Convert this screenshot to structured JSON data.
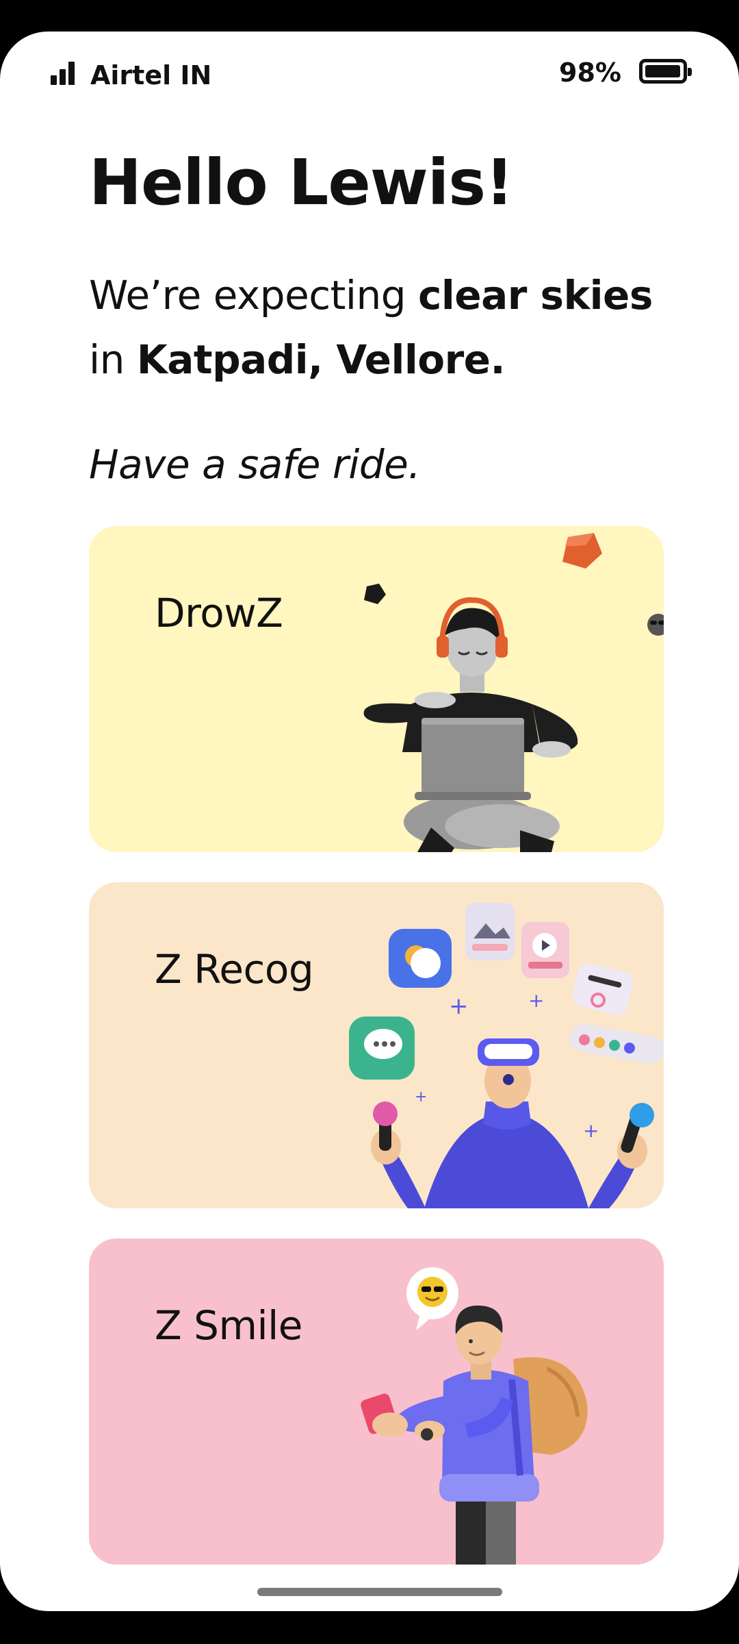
{
  "status_bar": {
    "carrier": "Airtel IN",
    "battery_percent_label": "98%",
    "battery_level": 0.98,
    "signal_bars": 3
  },
  "greeting": "Hello Lewis!",
  "forecast": {
    "prefix": "We’re expecting ",
    "condition": "clear skies",
    "middle": " in ",
    "location": "Katpadi, Vellore."
  },
  "tagline": "Have a safe ride.",
  "cards": [
    {
      "title": "DrowZ",
      "background": "#fff6c0"
    },
    {
      "title": "Z Recog",
      "background": "#fbe6c9"
    },
    {
      "title": "Z Smile",
      "background": "#f8c0cd"
    }
  ],
  "colors": {
    "text": "#111111",
    "accent_purple": "#5b5bf0",
    "orange": "#e0612e"
  }
}
